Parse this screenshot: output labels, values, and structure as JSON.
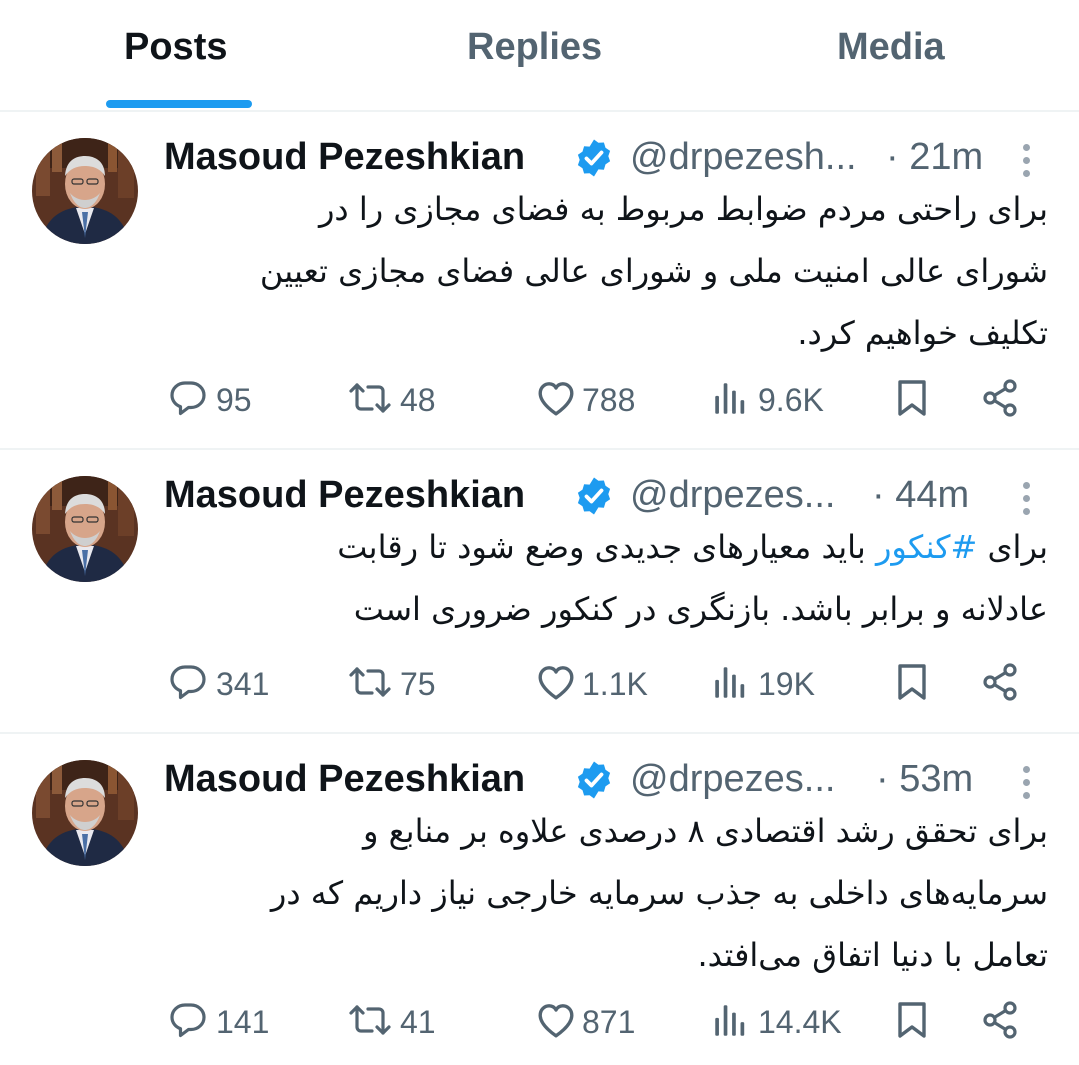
{
  "tabs": [
    {
      "label": "Posts",
      "active": true
    },
    {
      "label": "Replies",
      "active": false
    },
    {
      "label": "Media",
      "active": false
    }
  ],
  "colors": {
    "accent": "#1d9bf0",
    "text": "#0f1419",
    "muted": "#536471",
    "divider": "#eff3f4"
  },
  "tweets": [
    {
      "author_name": "Masoud Pezeshkian",
      "verified": true,
      "handle": "@drpezesh...",
      "time": "· 21m",
      "text_lines": [
        "برای راحتی مردم ضوابط مربوط به فضای مجازی را در",
        "شورای عالی امنیت ملی و شورای عالی فضای مجازی تعیین",
        "تکلیف خواهیم کرد."
      ],
      "replies": "95",
      "reposts": "48",
      "likes": "788",
      "views": "9.6K"
    },
    {
      "author_name": "Masoud Pezeshkian",
      "verified": true,
      "handle": "@drpezes...",
      "time": "· 44m",
      "text_line1_before": "برای ",
      "hashtag": "#کنکور",
      "text_line1_after": " باید معیارهای جدیدی وضع شود تا رقابت",
      "text_line2": "عادلانه و برابر باشد. بازنگری در کنکور ضروری است",
      "replies": "341",
      "reposts": "75",
      "likes": "1.1K",
      "views": "19K"
    },
    {
      "author_name": "Masoud Pezeshkian",
      "verified": true,
      "handle": "@drpezes...",
      "time": "· 53m",
      "text_lines": [
        "برای تحقق رشد اقتصادی ۸ درصدی علاوه بر منابع و",
        "سرمایه‌های داخلی به جذب سرمایه خارجی نیاز داریم که در",
        "تعامل با دنیا اتفاق می‌افتد."
      ],
      "replies": "141",
      "reposts": "41",
      "likes": "871",
      "views": "14.4K"
    }
  ],
  "icons": {
    "reply": "reply-icon",
    "repost": "repost-icon",
    "like": "like-icon",
    "views": "views-icon",
    "bookmark": "bookmark-icon",
    "share": "share-icon",
    "more": "more-icon",
    "verified": "verified-badge-icon"
  }
}
